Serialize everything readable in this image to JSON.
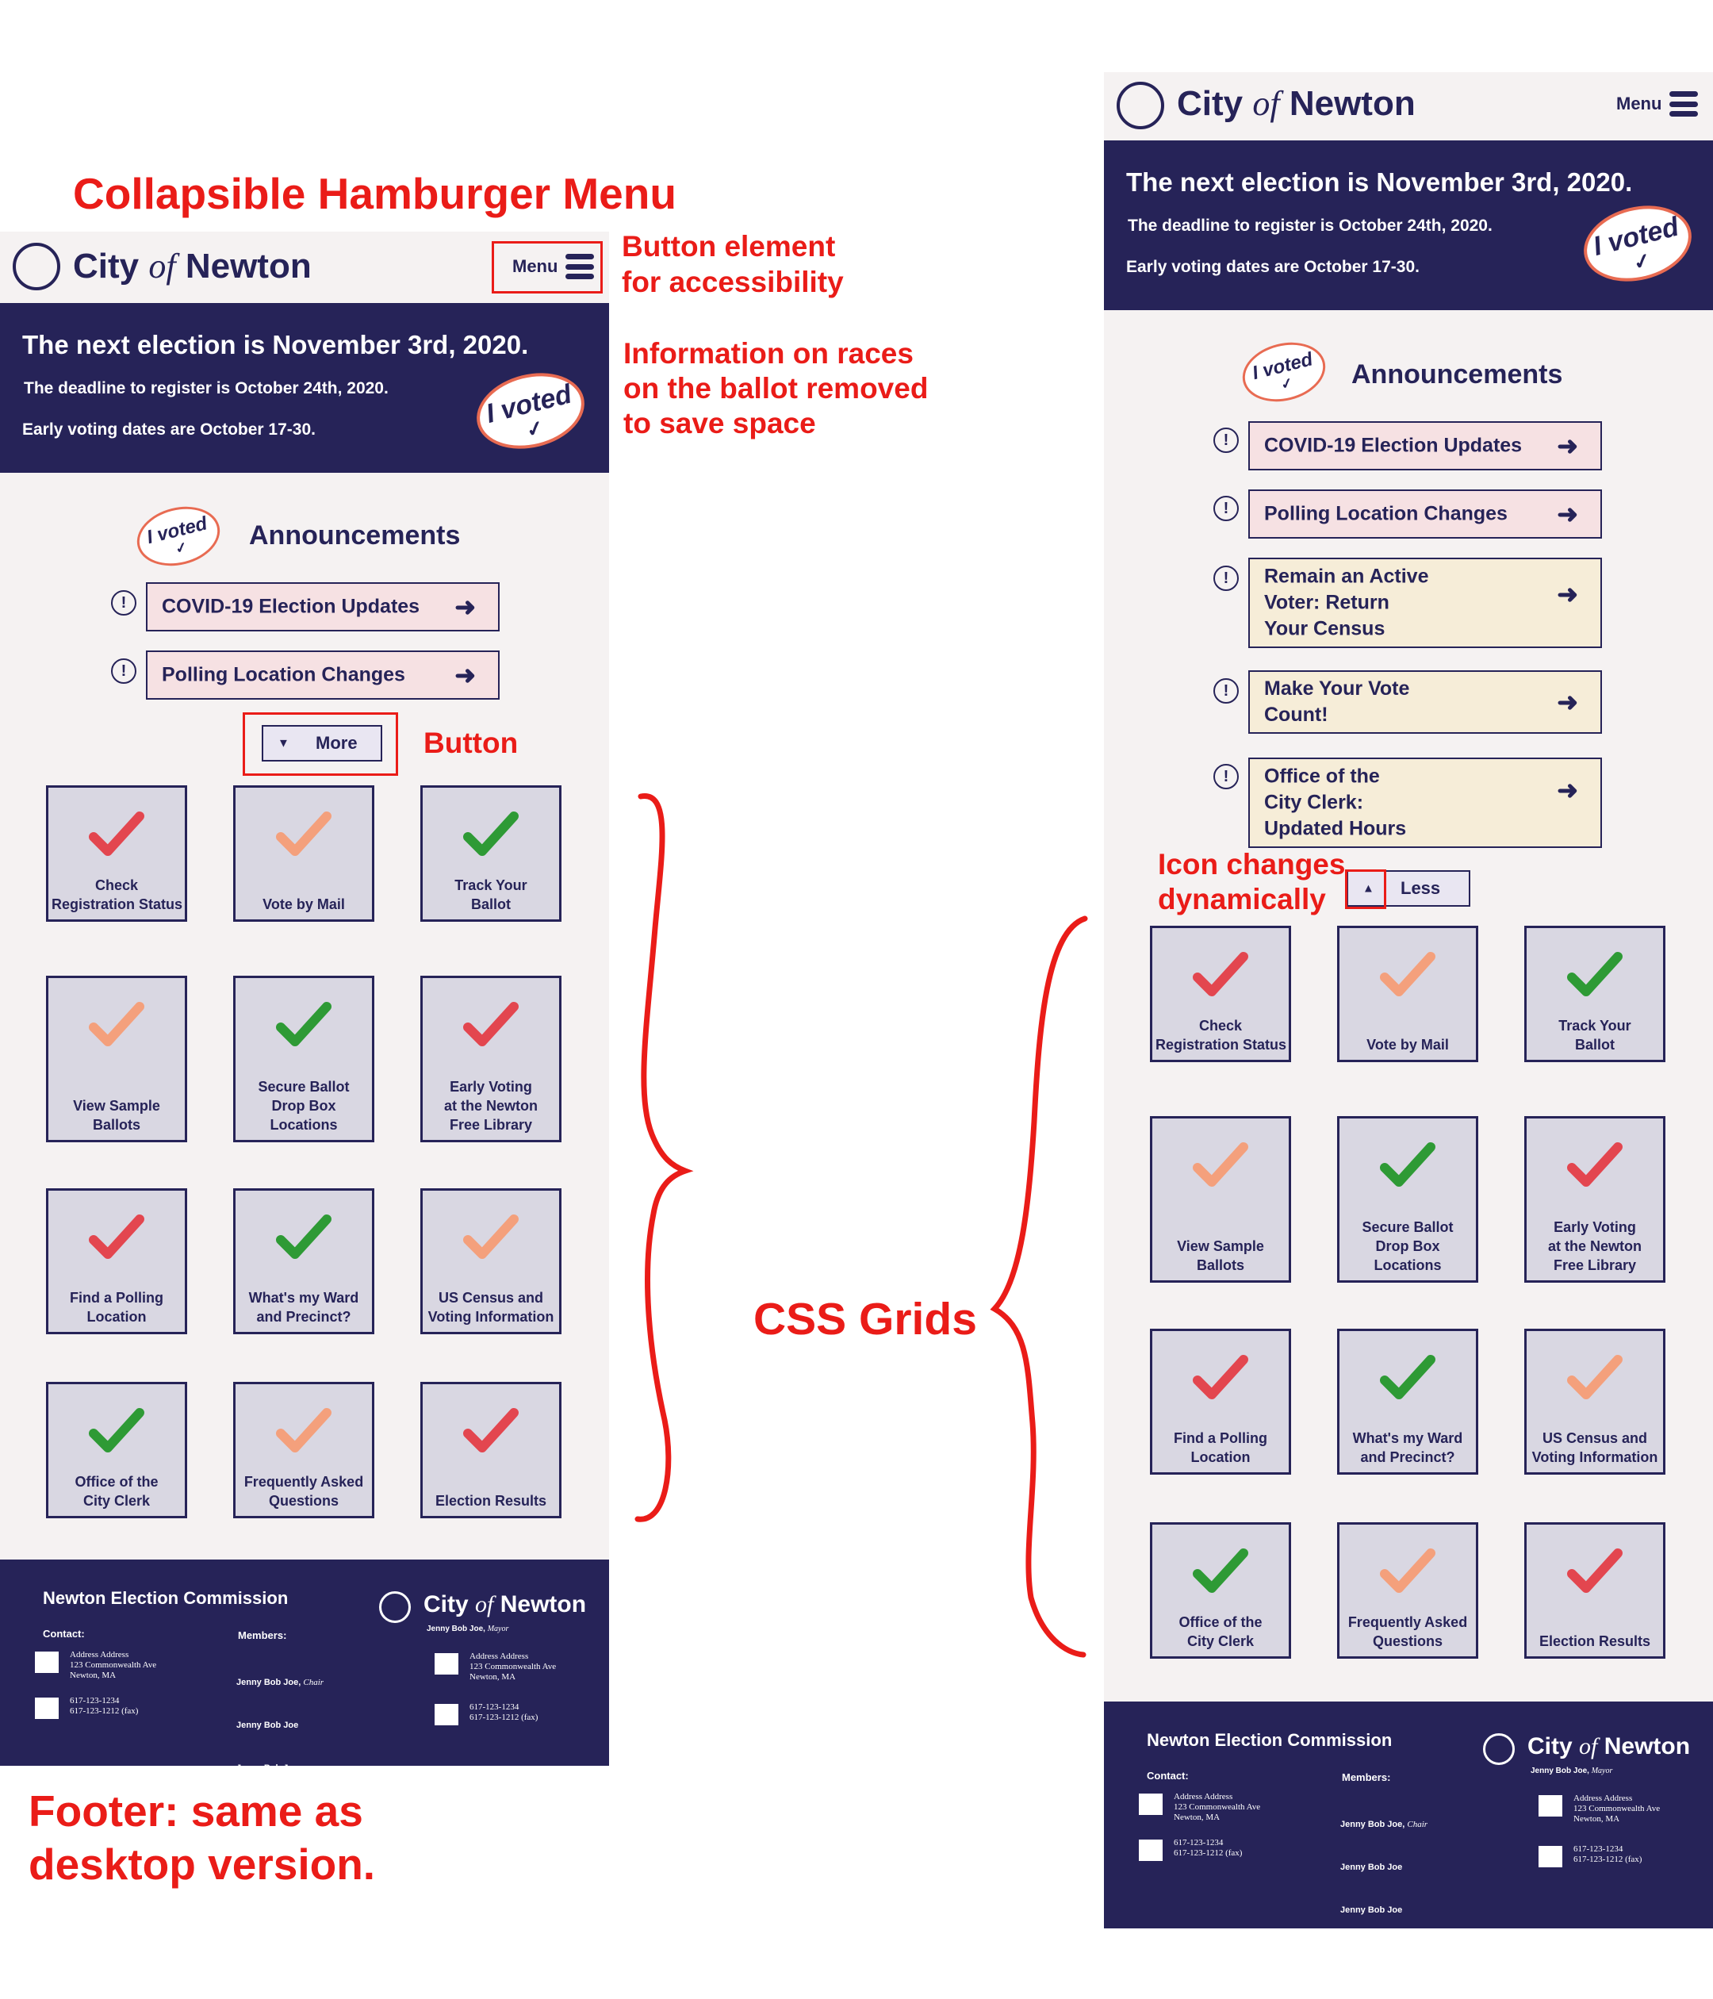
{
  "site": {
    "city": "City",
    "of": "of",
    "name": "Newton",
    "menu_label": "Menu"
  },
  "banner": {
    "title": "The next election is November 3rd, 2020.",
    "deadline": "The deadline to register is October 24th, 2020.",
    "early_voting": "Early voting dates are October 17-30.",
    "sticker_text": "I voted",
    "sticker_check": "✓"
  },
  "announcements": {
    "title": "Announcements",
    "sticker_text": "I voted",
    "sticker_check": "✓",
    "items": [
      {
        "label": "COVID-19 Election Updates",
        "icon": "!",
        "arrow": "➜"
      },
      {
        "label": "Polling Location Changes",
        "icon": "!",
        "arrow": "➜"
      },
      {
        "label": "Remain an Active\nVoter: Return\nYour Census",
        "icon": "!",
        "arrow": "➜"
      },
      {
        "label": "Make Your Vote\nCount!",
        "icon": "!",
        "arrow": "➜"
      },
      {
        "label": "Office of the\nCity Clerk:\nUpdated Hours",
        "icon": "!",
        "arrow": "➜"
      }
    ],
    "more_label": "More",
    "less_label": "Less"
  },
  "tiles": [
    {
      "label": "Check\nRegistration Status",
      "check": "red"
    },
    {
      "label": "Vote by Mail",
      "check": "salmon"
    },
    {
      "label": "Track Your\nBallot",
      "check": "green"
    },
    {
      "label": "View Sample\nBallots",
      "check": "salmon"
    },
    {
      "label": "Secure Ballot\nDrop Box\nLocations",
      "check": "green"
    },
    {
      "label": "Early Voting\nat the Newton\nFree Library",
      "check": "red"
    },
    {
      "label": "Find a Polling\nLocation",
      "check": "red"
    },
    {
      "label": "What's my Ward\nand Precinct?",
      "check": "green"
    },
    {
      "label": "US Census and\nVoting Information",
      "check": "salmon"
    },
    {
      "label": "Office of the\nCity Clerk",
      "check": "green"
    },
    {
      "label": "Frequently Asked\nQuestions",
      "check": "salmon"
    },
    {
      "label": "Election Results",
      "check": "red"
    }
  ],
  "footer": {
    "commission": "Newton Election Commission",
    "contact_heading": "Contact:",
    "members_heading": "Members:",
    "address": "Address Address\n123 Commonwealth Ave\nNewton, MA",
    "phone": "617-123-1234\n617-123-1212 (fax)",
    "members": [
      {
        "name": "Jenny Bob Joe,",
        "role": "Chair"
      },
      {
        "name": "Jenny Bob Joe",
        "role": ""
      },
      {
        "name": "Jenny Bob Joe",
        "role": ""
      },
      {
        "name": "Jenny Bob Joe",
        "role": ""
      }
    ],
    "mayor_name": "Jenny Bob Joe,",
    "mayor_role": "Mayor"
  },
  "annotations": {
    "hamburger": "Collapsible Hamburger Menu",
    "button_element": "Button element\nfor accessibility",
    "races_removed": "Information on races\non the ballot removed\nto save space",
    "button": "Button",
    "css_grids": "CSS Grids",
    "icon_changes": "Icon changes\ndynamically",
    "footer_note": "Footer: same as\ndesktop version."
  },
  "colors": {
    "navy": "#262358",
    "background": "#f5f2f2",
    "tile": "#d9d7e2",
    "pink": "#f6e1e3",
    "cream": "#f6edd8",
    "annotation_red": "#ea1c18",
    "check_red": "#e3464f",
    "check_salmon": "#f4a07c",
    "check_green": "#2e9a35",
    "sticker_border": "#e86b52"
  }
}
